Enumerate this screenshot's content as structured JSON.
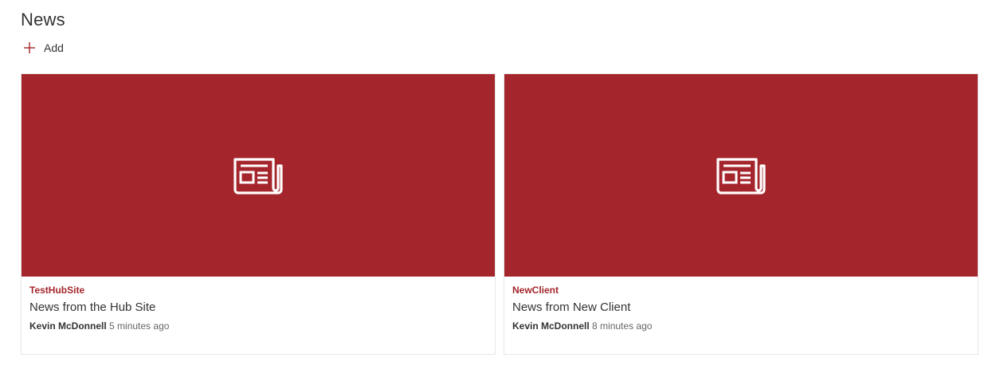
{
  "webpart": {
    "title": "News",
    "add_label": "Add",
    "accent_color": "#a4262c"
  },
  "news": [
    {
      "site": "TestHubSite",
      "title": "News from the Hub Site",
      "author": "Kevin McDonnell",
      "time": "5 minutes ago",
      "thumbnail_icon": "newspaper-icon"
    },
    {
      "site": "NewClient",
      "title": "News from New Client",
      "author": "Kevin McDonnell",
      "time": "8 minutes ago",
      "thumbnail_icon": "newspaper-icon"
    }
  ]
}
